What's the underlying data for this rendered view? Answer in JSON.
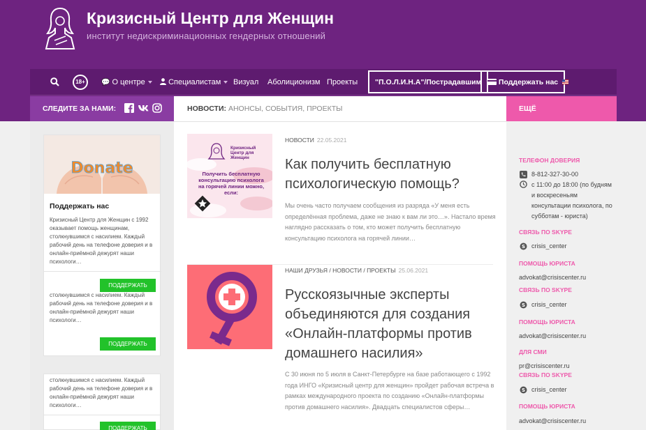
{
  "site": {
    "title": "Кризисный Центр для Женщин",
    "tagline": "институт недискриминационных гендерных отношений",
    "accent": "#6e2380",
    "pink": "#ee59ab",
    "green": "#22c22a"
  },
  "nav": {
    "search_icon": "search-icon",
    "age_badge": "18+",
    "items": [
      "О центре",
      "Специалистам",
      "Визуал",
      "Аболиционизм",
      "Проекты"
    ],
    "box1": "\"П.О.Л.И.Н.А\"/Пострадавшим",
    "box2": "Поддержать нас"
  },
  "follow": {
    "label": "СЛЕДИТЕ ЗА НАМИ:",
    "icons": [
      "facebook-icon",
      "vk-icon",
      "instagram-icon"
    ]
  },
  "breadcrumb": {
    "main": "НОВОСТИ:",
    "rest": "АНОНСЫ, СОБЫТИЯ, ПРОЕКТЫ"
  },
  "more_label": "ЕЩЁ",
  "widgets": [
    {
      "image_text": "Donate",
      "title": "Поддержать нас",
      "text": "Кризисный Центр для Женщин с 1992 оказывает помощь женщинам, столкнувшимся с насилием. Каждый рабочий день на телефоне доверия и в онлайн-приёмной дежурят наши психологи…",
      "button": "ПОДДЕРЖАТЬ"
    },
    {
      "text": "столкнувшимся с насилием. Каждый рабочий день на телефоне доверия и в онлайн-приёмной дежурят наши психологи…",
      "button": "ПОДДЕРЖАТЬ"
    },
    {
      "text": "столкнувшимся с насилием. Каждый рабочий день на телефоне доверия и в онлайн-приёмной дежурят наши психологи…",
      "button": "ПОДДЕРЖАТЬ"
    }
  ],
  "posts": [
    {
      "categories": "НОВОСТИ",
      "date": "22.05.2021",
      "title": "Как получить бесплатную психологическую помощь?",
      "excerpt": "Мы очень часто получаем сообщения из разряда «У меня есть определённая проблема, даже не знаю к вам ли это…». Настало время наглядно рассказать о том, кто может получить бесплатную консультацию психолога на горячей линии…",
      "thumb_title": "Кризисный Центр для Женщин",
      "thumb_text": "Получить бесплатную консультацию психолога на горячей линии можно, если:"
    },
    {
      "categories": "НАШИ ДРУЗЬЯ / НОВОСТИ / ПРОЕКТЫ",
      "date": "25.06.2021",
      "title": "Русскоязычные эксперты объединяются для создания «Онлайн-платформы против домашнего насилия»",
      "excerpt": "С 30 июня по 5 июля в Санкт-Петербурге на базе работающего с 1992 года ИНГО  «Кризисный центр для женщин»  пройдет рабочая встреча в рамках международного проекта по созданию «Онлайн-платформы против домашнего насилия». Двадцать специалистов сферы…"
    }
  ],
  "right": {
    "hotline_title": "ТЕЛЕФОН ДОВЕРИЯ",
    "phone": "8-812-327-30-00",
    "hours": "с 11:00 до 18:00 (по будням и воскресеньям консультации психолога, по субботам - юриста)",
    "skype_title": "СВЯЗЬ ПО SKYPE",
    "skype": "crisis_center",
    "lawyer_title": "ПОМОЩЬ ЮРИСТА",
    "lawyer_email": "advokat@crisiscenter.ru",
    "press_title": "ДЛЯ СМИ",
    "press_email": "pr@crisiscenter.ru"
  }
}
